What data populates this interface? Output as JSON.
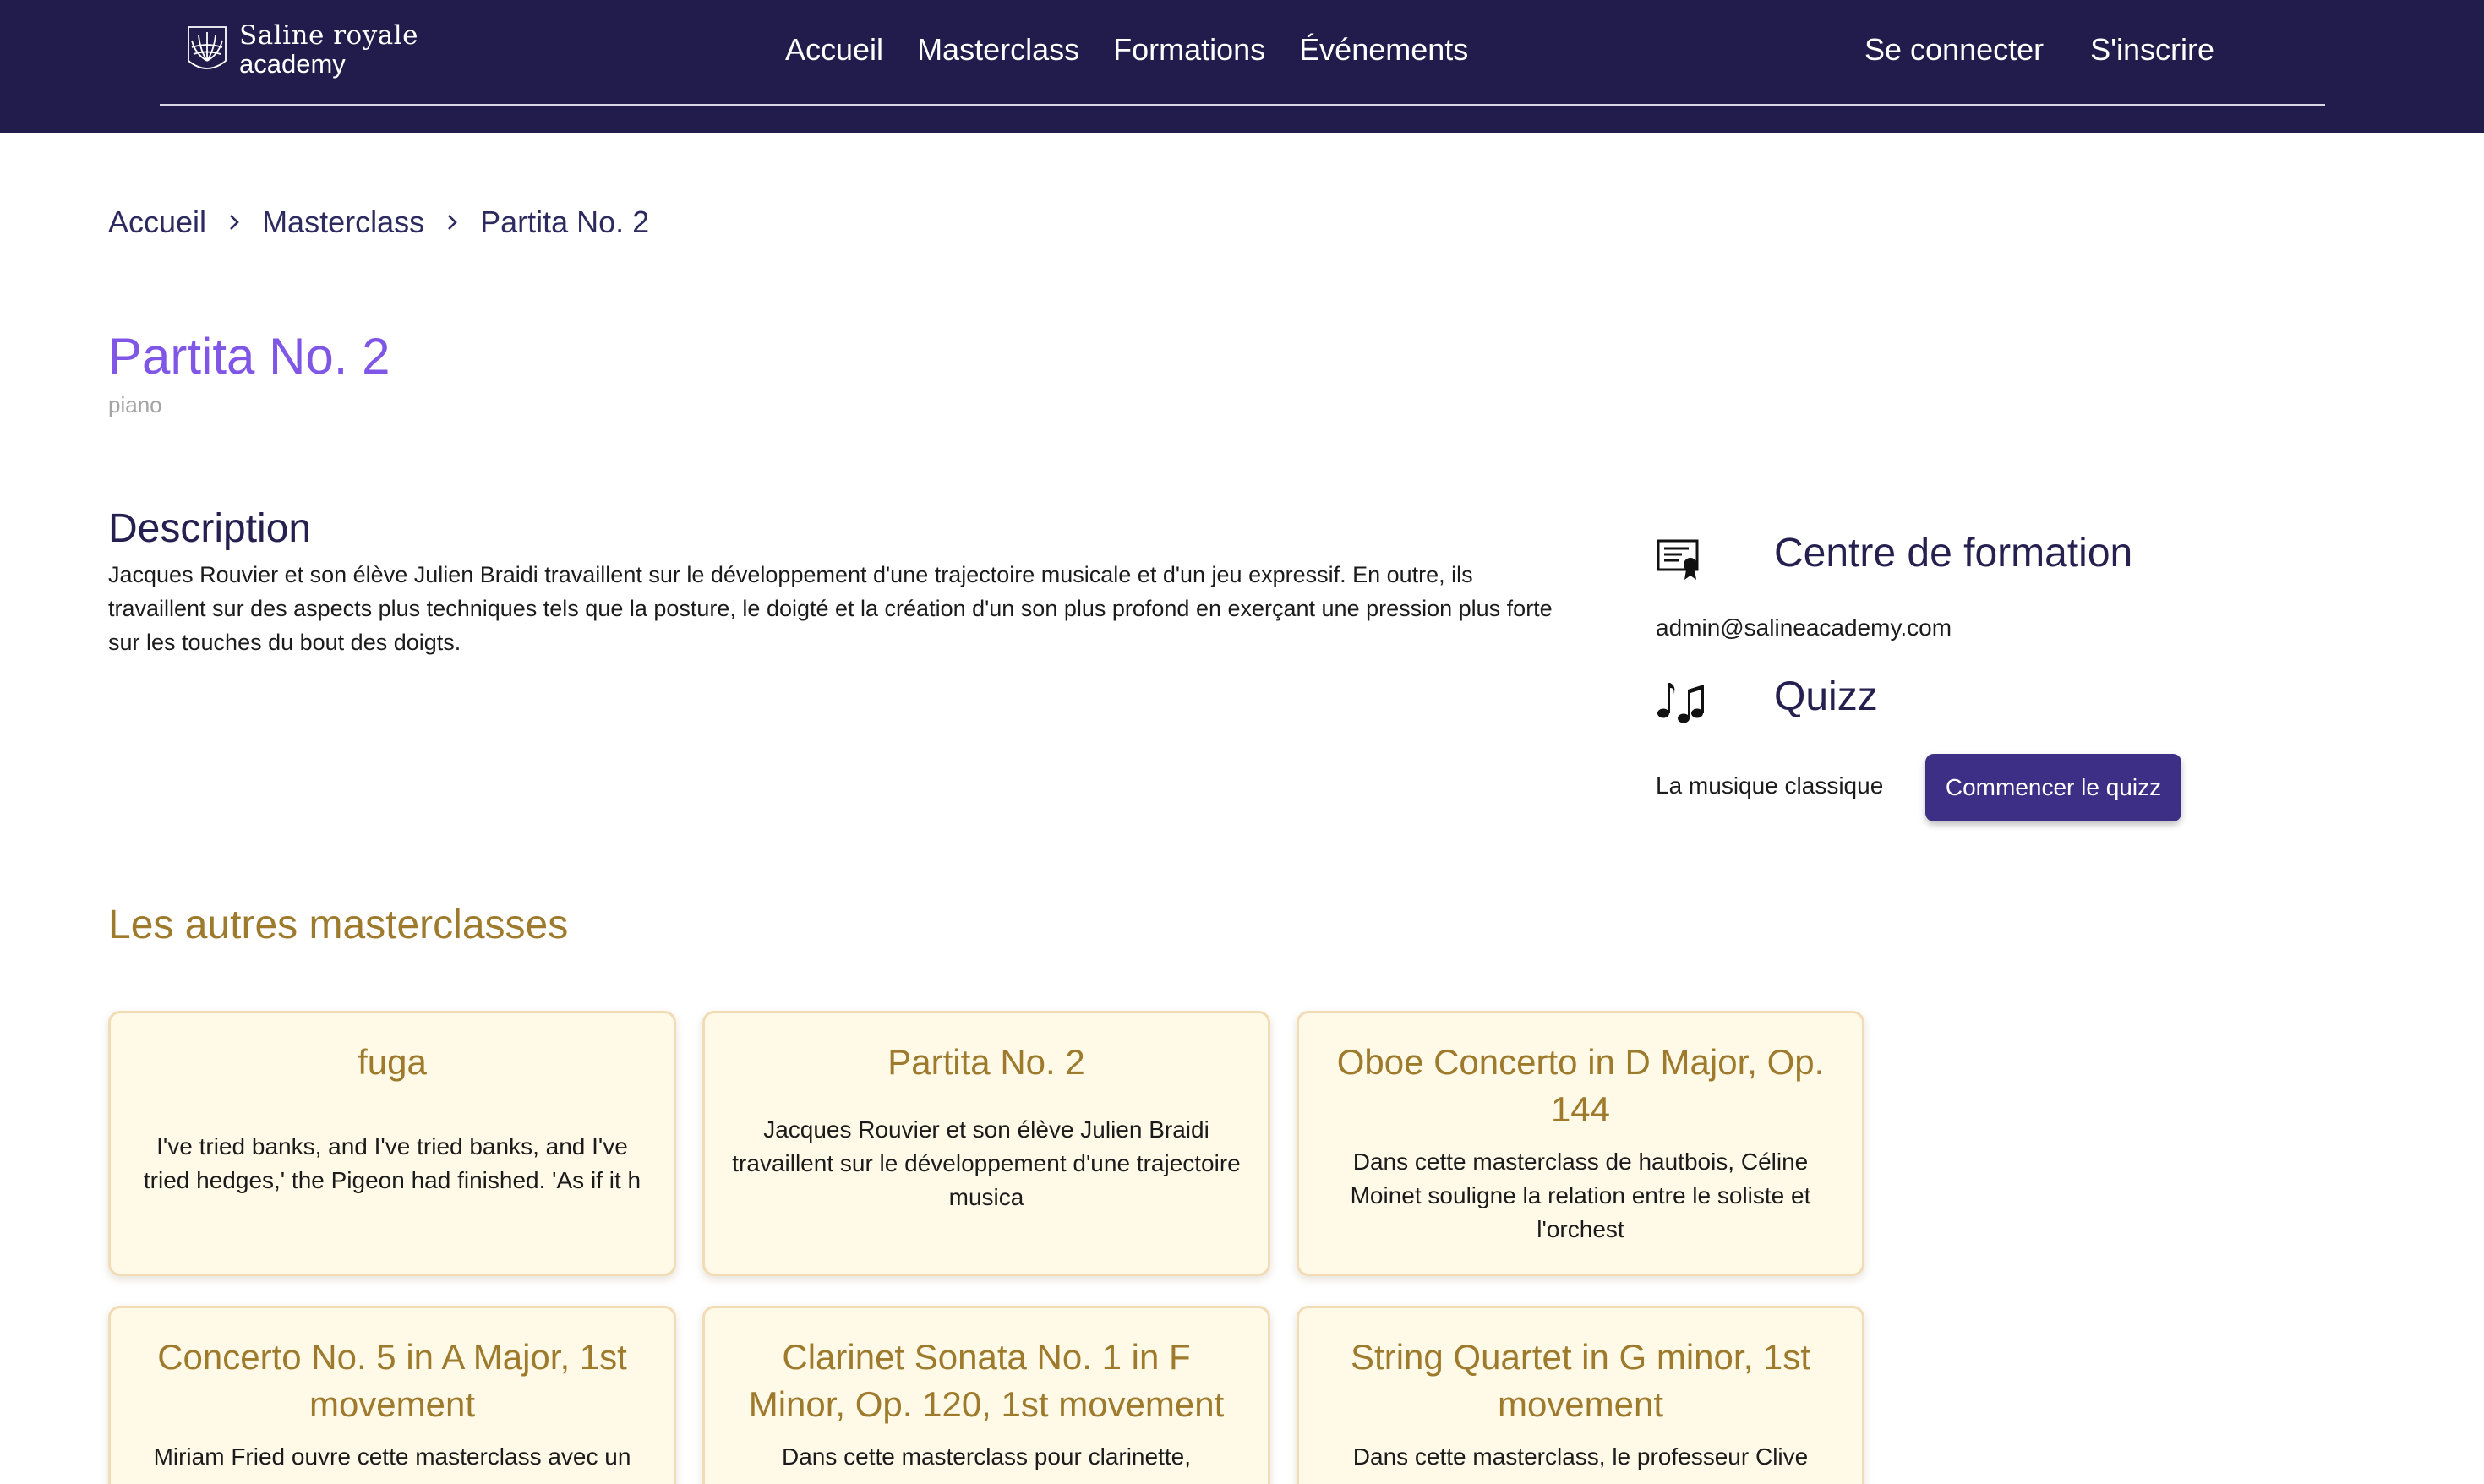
{
  "header": {
    "logo_line1": "Saline royale",
    "logo_line2": "academy",
    "nav": [
      {
        "label": "Accueil"
      },
      {
        "label": "Masterclass"
      },
      {
        "label": "Formations"
      },
      {
        "label": "Événements"
      }
    ],
    "auth": {
      "login_label": "Se connecter",
      "signup_label": "S'inscrire"
    }
  },
  "breadcrumb": [
    "Accueil",
    "Masterclass",
    "Partita No. 2"
  ],
  "page": {
    "title": "Partita No. 2",
    "instrument": "piano"
  },
  "description": {
    "heading": "Description",
    "text": "Jacques Rouvier et son élève Julien Braidi travaillent sur le développement d'une trajectoire musicale et d'un jeu expressif. En outre, ils travaillent sur des aspects plus techniques tels que la posture, le doigté et la création d'un son plus profond en exerçant une pression plus forte sur les touches du bout des doigts."
  },
  "sidebar": {
    "training_center": {
      "heading": "Centre de formation",
      "email": "admin@salineacademy.com",
      "icon": "certificate-icon"
    },
    "quiz": {
      "heading": "Quizz",
      "topic": "La musique classique",
      "button_label": "Commencer le quizz",
      "icon": "music-notes-icon"
    }
  },
  "others": {
    "heading": "Les autres masterclasses",
    "cards": [
      {
        "title": "fuga",
        "text": "I've tried banks, and I've tried banks, and I've tried hedges,' the Pigeon had finished. 'As if it h"
      },
      {
        "title": "Partita No. 2",
        "text": "Jacques Rouvier et son élève Julien Braidi travaillent sur le développement d'une trajectoire musica"
      },
      {
        "title": "Oboe Concerto in D Major, Op. 144",
        "text": "Dans cette masterclass de hautbois, Céline Moinet souligne la relation entre le soliste et l'orchest"
      },
      {
        "title": "Concerto No. 5 in A Major, 1st movement",
        "text": "Miriam Fried ouvre cette masterclass avec un"
      },
      {
        "title": "Clarinet Sonata No. 1 in F Minor, Op. 120, 1st movement",
        "text": "Dans cette masterclass pour clarinette,"
      },
      {
        "title": "String Quartet in G minor, 1st movement",
        "text": "Dans cette masterclass, le professeur Clive"
      }
    ]
  },
  "colors": {
    "navbar": "#221c4c",
    "title_purple": "#7f56e6",
    "heading_navy": "#25204f",
    "gold": "#9e7a2c",
    "card_bg": "#fff9e8",
    "button": "#3e2f86"
  }
}
